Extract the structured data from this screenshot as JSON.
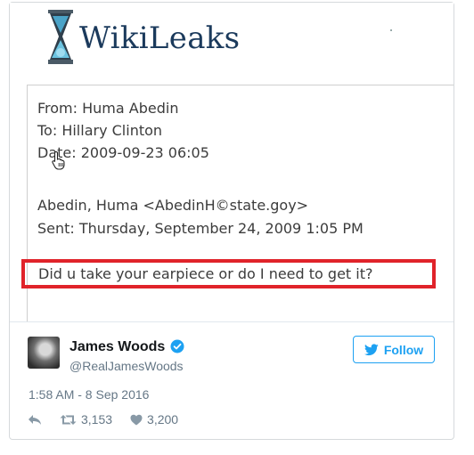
{
  "brand": {
    "name": "WikiLeaks"
  },
  "email": {
    "from": "From: Huma Abedin",
    "to": "To: Hillary Clinton",
    "date": "Date: 2009-09-23 06:05",
    "sender": "Abedin, Huma <AbedinH©state.goy>",
    "sent": "Sent: Thursday, September 24, 2009 1:05 PM",
    "body": "Did u take your earpiece or do I need to get it?"
  },
  "colors": {
    "highlight": "#e0232a",
    "accent": "#1da1f2"
  },
  "tweet": {
    "author_name": "James Woods",
    "handle": "@RealJamesWoods",
    "follow_label": "Follow",
    "timestamp": "1:58 AM - 8 Sep 2016",
    "retweets": "3,153",
    "likes": "3,200"
  },
  "icons": [
    "hourglass-logo-icon",
    "pointer-cursor-icon",
    "verified-badge-icon",
    "twitter-bird-icon",
    "reply-icon",
    "retweet-icon",
    "like-heart-icon"
  ]
}
